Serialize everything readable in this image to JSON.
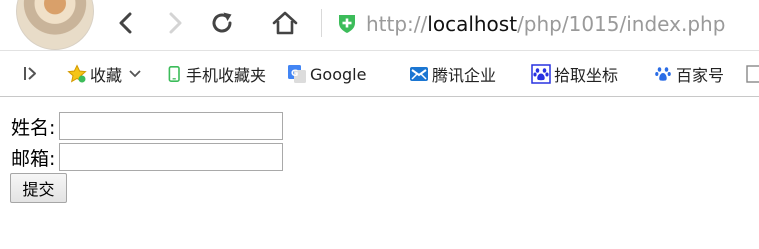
{
  "browser": {
    "url_scheme": "http://",
    "url_host": "localhost",
    "url_path": "/php/1015/index.php",
    "secure_badge_color": "#3cbc5a"
  },
  "bookmarks": {
    "items": [
      {
        "label": "收藏",
        "icon": "star-icon"
      },
      {
        "label": "手机收藏夹",
        "icon": "phone-icon"
      },
      {
        "label": "Google",
        "icon": "google-translate-icon"
      },
      {
        "label": "腾讯企业",
        "icon": "tencent-mail-icon"
      },
      {
        "label": "拾取坐标",
        "icon": "baidu-paw-icon"
      },
      {
        "label": "百家号",
        "icon": "baijiahao-icon"
      }
    ]
  },
  "form": {
    "name_label": "姓名:",
    "name_value": "",
    "email_label": "邮箱:",
    "email_value": "",
    "submit_label": "提交"
  }
}
